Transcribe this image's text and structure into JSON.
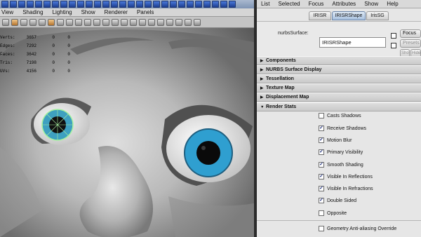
{
  "viewport": {
    "menu": [
      "View",
      "Shading",
      "Lighting",
      "Show",
      "Renderer",
      "Panels"
    ],
    "stats": [
      {
        "label": "Verts:",
        "a": "3657",
        "b": "0",
        "c": "0"
      },
      {
        "label": "Edges:",
        "a": "7292",
        "b": "0",
        "c": "0"
      },
      {
        "label": "Faces:",
        "a": "3642",
        "b": "0",
        "c": "0"
      },
      {
        "label": "Tris:",
        "a": "7198",
        "b": "0",
        "c": "0"
      },
      {
        "label": "UVs:",
        "a": "4156",
        "b": "0",
        "c": "0"
      }
    ],
    "colors": {
      "iris_left": "#3ea0c0",
      "iris_right": "#2f9fd0",
      "skin": "#b8b8b8"
    }
  },
  "attribute_editor": {
    "menu": [
      "List",
      "Selected",
      "Focus",
      "Attributes",
      "Show",
      "Help"
    ],
    "tabs": [
      "IRISR",
      "IRISRShape",
      "IrisSG"
    ],
    "active_tab": "IRISRShape",
    "node_type_label": "nurbsSurface:",
    "node_name": "IRISRShape",
    "side_buttons": {
      "focus": "Focus",
      "presets": "Presets",
      "show": "Show",
      "hide": "Hide"
    },
    "sections": {
      "components": "Components",
      "nurbs_display": "NURBS Surface Display",
      "tessellation": "Tessellation",
      "texture_map": "Texture Map",
      "displacement_map": "Displacement Map",
      "render_stats": "Render Stats"
    },
    "render_stats": [
      {
        "label": "Casts Shadows",
        "checked": false
      },
      {
        "label": "Receive Shadows",
        "checked": true
      },
      {
        "label": "Motion Blur",
        "checked": true
      },
      {
        "label": "Primary Visibility",
        "checked": true
      },
      {
        "label": "Smooth Shading",
        "checked": true
      },
      {
        "label": "Visible In Reflections",
        "checked": true
      },
      {
        "label": "Visible In Refractions",
        "checked": true
      },
      {
        "label": "Double Sided",
        "checked": true
      },
      {
        "label": "Opposite",
        "checked": false
      }
    ],
    "geometry_aa": {
      "label": "Geometry Anti-aliasing Override",
      "checked": false
    }
  }
}
